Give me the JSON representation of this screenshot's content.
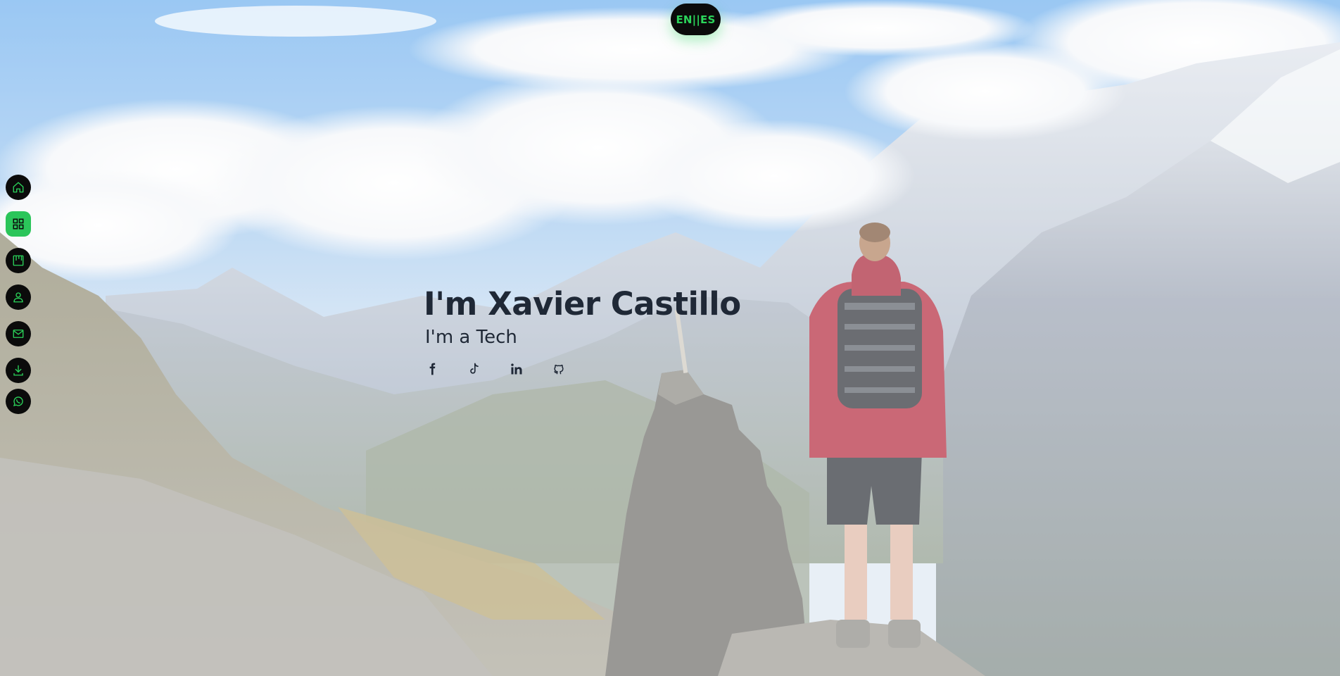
{
  "language_toggle": {
    "label": "EN||ES"
  },
  "side_nav": {
    "items": [
      {
        "id": "home",
        "icon": "home-icon",
        "active": false
      },
      {
        "id": "portfolio",
        "icon": "grid-icon",
        "active": true
      },
      {
        "id": "experience",
        "icon": "board-icon",
        "active": false
      },
      {
        "id": "about",
        "icon": "user-icon",
        "active": false
      },
      {
        "id": "contact",
        "icon": "mail-icon",
        "active": false
      },
      {
        "id": "download",
        "icon": "download-icon",
        "active": false
      },
      {
        "id": "whatsapp",
        "icon": "whatsapp-icon",
        "active": false
      }
    ]
  },
  "hero": {
    "name": "I'm Xavier Castillo",
    "role": "I'm a Tech"
  },
  "socials": [
    {
      "id": "facebook",
      "icon": "facebook-icon"
    },
    {
      "id": "tiktok",
      "icon": "tiktok-icon"
    },
    {
      "id": "linkedin",
      "icon": "linkedin-icon"
    },
    {
      "id": "github",
      "icon": "github-icon"
    }
  ],
  "colors": {
    "accent": "#2bc55a",
    "nav_bg": "#0b0b0b",
    "heading": "#1f2836"
  }
}
